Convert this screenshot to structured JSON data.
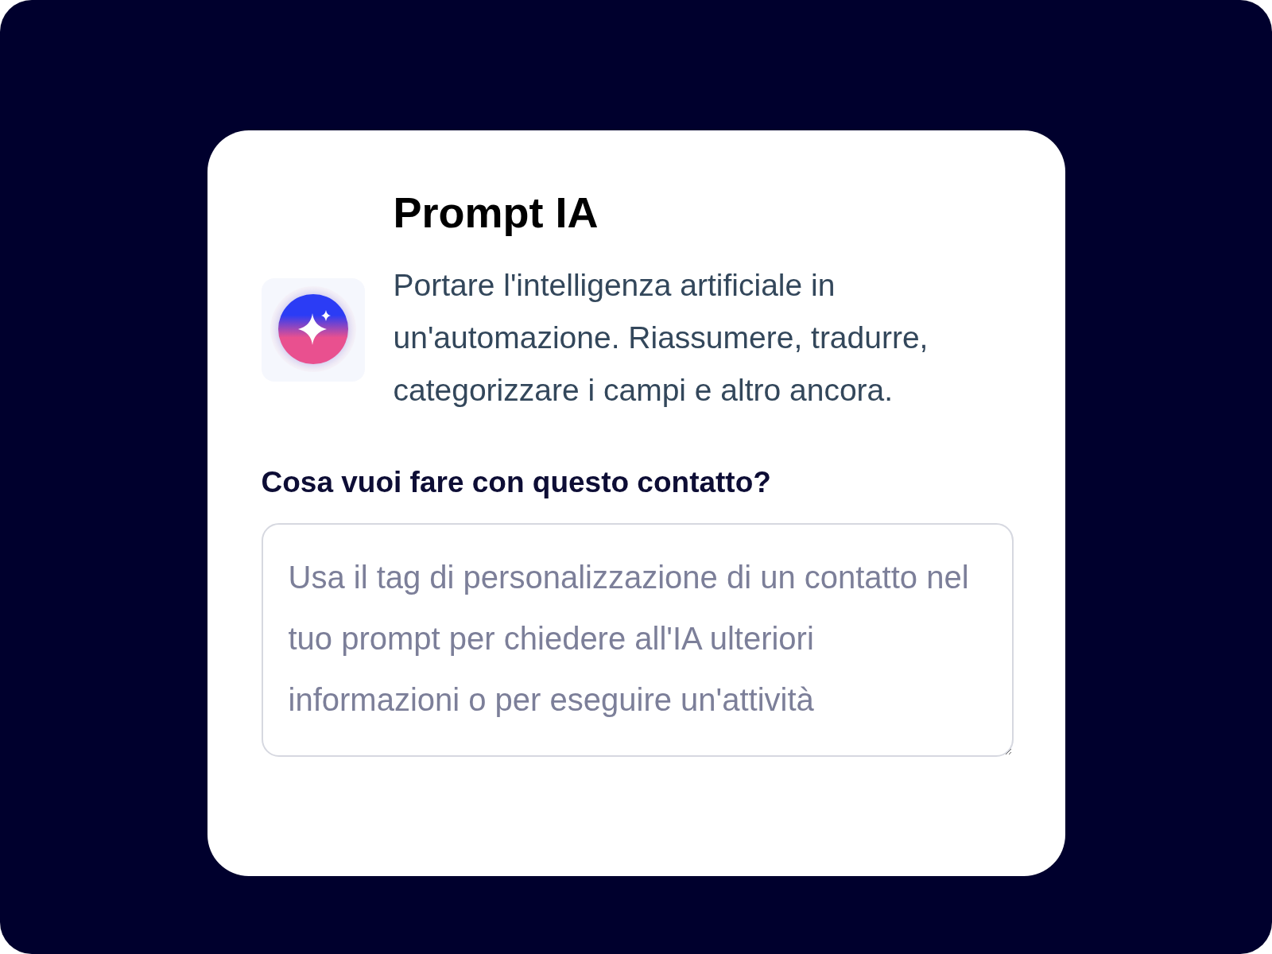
{
  "card": {
    "title": "Prompt IA",
    "description": "Portare l'intelligenza artificiale in un'automazione. Riassumere, tradurre, categorizzare i campi e altro ancora.",
    "field": {
      "label": "Cosa vuoi fare con questo contatto?",
      "placeholder": "Usa il tag di personalizzazione di un contatto nel tuo prompt per chiedere all'IA ulteriori informazioni o per eseguire un'attività"
    }
  }
}
